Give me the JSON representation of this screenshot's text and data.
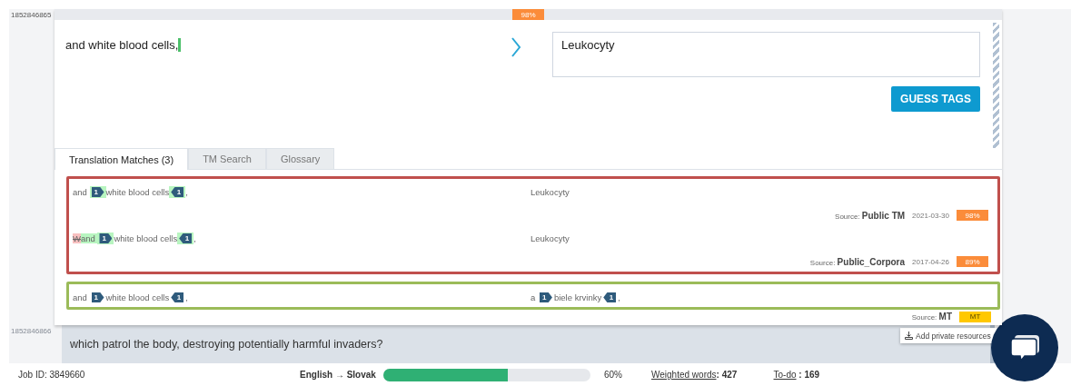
{
  "segments": [
    {
      "kind": "active",
      "id": "1852846865",
      "score": "98%",
      "source": "and white blood cells,",
      "target": "Leukocyty",
      "guess_button": "GUESS TAGS",
      "tabs": [
        {
          "label": "Translation Matches (3)",
          "selected": true
        },
        {
          "label": "TM Search",
          "selected": false
        },
        {
          "label": "Glossary",
          "selected": false
        }
      ],
      "match_groups": [
        {
          "color": "#c0504d",
          "matches": [
            {
              "source": [
                {
                  "kind": "text",
                  "text": "and ",
                  "added": false,
                  "deleted": false
                },
                {
                  "kind": "tag_open",
                  "text": "1",
                  "added": true,
                  "deleted": false
                },
                {
                  "kind": "text",
                  "text": "white blood cells",
                  "added": false,
                  "deleted": false
                },
                {
                  "kind": "tag_close",
                  "text": "1",
                  "added": true,
                  "deleted": false
                },
                {
                  "kind": "text",
                  "text": ",",
                  "added": false,
                  "deleted": false
                }
              ],
              "target": [
                {
                  "kind": "text",
                  "text": "Leukocyty"
                }
              ],
              "meta": {
                "label": "Source:",
                "source": "Public TM",
                "date": "2021-03-30",
                "score": "98%",
                "machine": false
              }
            },
            {
              "source": [
                {
                  "kind": "text",
                  "text": "W",
                  "added": false,
                  "deleted": true
                },
                {
                  "kind": "text",
                  "text": "and ",
                  "added": true,
                  "deleted": false
                },
                {
                  "kind": "tag_open",
                  "text": "1",
                  "added": true,
                  "deleted": false
                },
                {
                  "kind": "text",
                  "text": "white blood cells",
                  "added": false,
                  "deleted": false
                },
                {
                  "kind": "tag_close",
                  "text": "1",
                  "added": true,
                  "deleted": false
                },
                {
                  "kind": "text",
                  "text": ",",
                  "added": false,
                  "deleted": false
                }
              ],
              "target": [
                {
                  "kind": "text",
                  "text": "Leukocyty"
                }
              ],
              "meta": {
                "label": "Source:",
                "source": "Public_Corpora",
                "date": "2017-04-26",
                "score": "89%",
                "machine": false
              }
            }
          ]
        },
        {
          "color": "#9bbb59",
          "matches": [
            {
              "source": [
                {
                  "kind": "text",
                  "text": "and "
                },
                {
                  "kind": "tag_open",
                  "text": "1"
                },
                {
                  "kind": "text",
                  "text": "white blood cells"
                },
                {
                  "kind": "tag_close",
                  "text": "1"
                },
                {
                  "kind": "text",
                  "text": ","
                }
              ],
              "target": [
                {
                  "kind": "text",
                  "text": "a "
                },
                {
                  "kind": "tag_open",
                  "text": "1"
                },
                {
                  "kind": "text",
                  "text": "biele krvinky"
                },
                {
                  "kind": "tag_close",
                  "text": "1"
                },
                {
                  "kind": "text",
                  "text": ","
                }
              ]
            }
          ],
          "footer": {
            "label": "Source:",
            "source": "MT",
            "score": "MT",
            "machine": true
          }
        }
      ]
    },
    {
      "kind": "next",
      "id": "1852846866",
      "source": "which patrol the body, destroying potentially harmful invaders?"
    }
  ],
  "private_resources": "Add private resources",
  "status_bar": {
    "job_id": "Job ID: 3849660",
    "language_pair": "English → Slovak",
    "progress": {
      "level": 0.6
    },
    "progress_text": "60%",
    "weighted_label": "Weighted words",
    "weighted_value": ": 427",
    "todo_label": "To-do",
    "todo_value": " : 169"
  }
}
